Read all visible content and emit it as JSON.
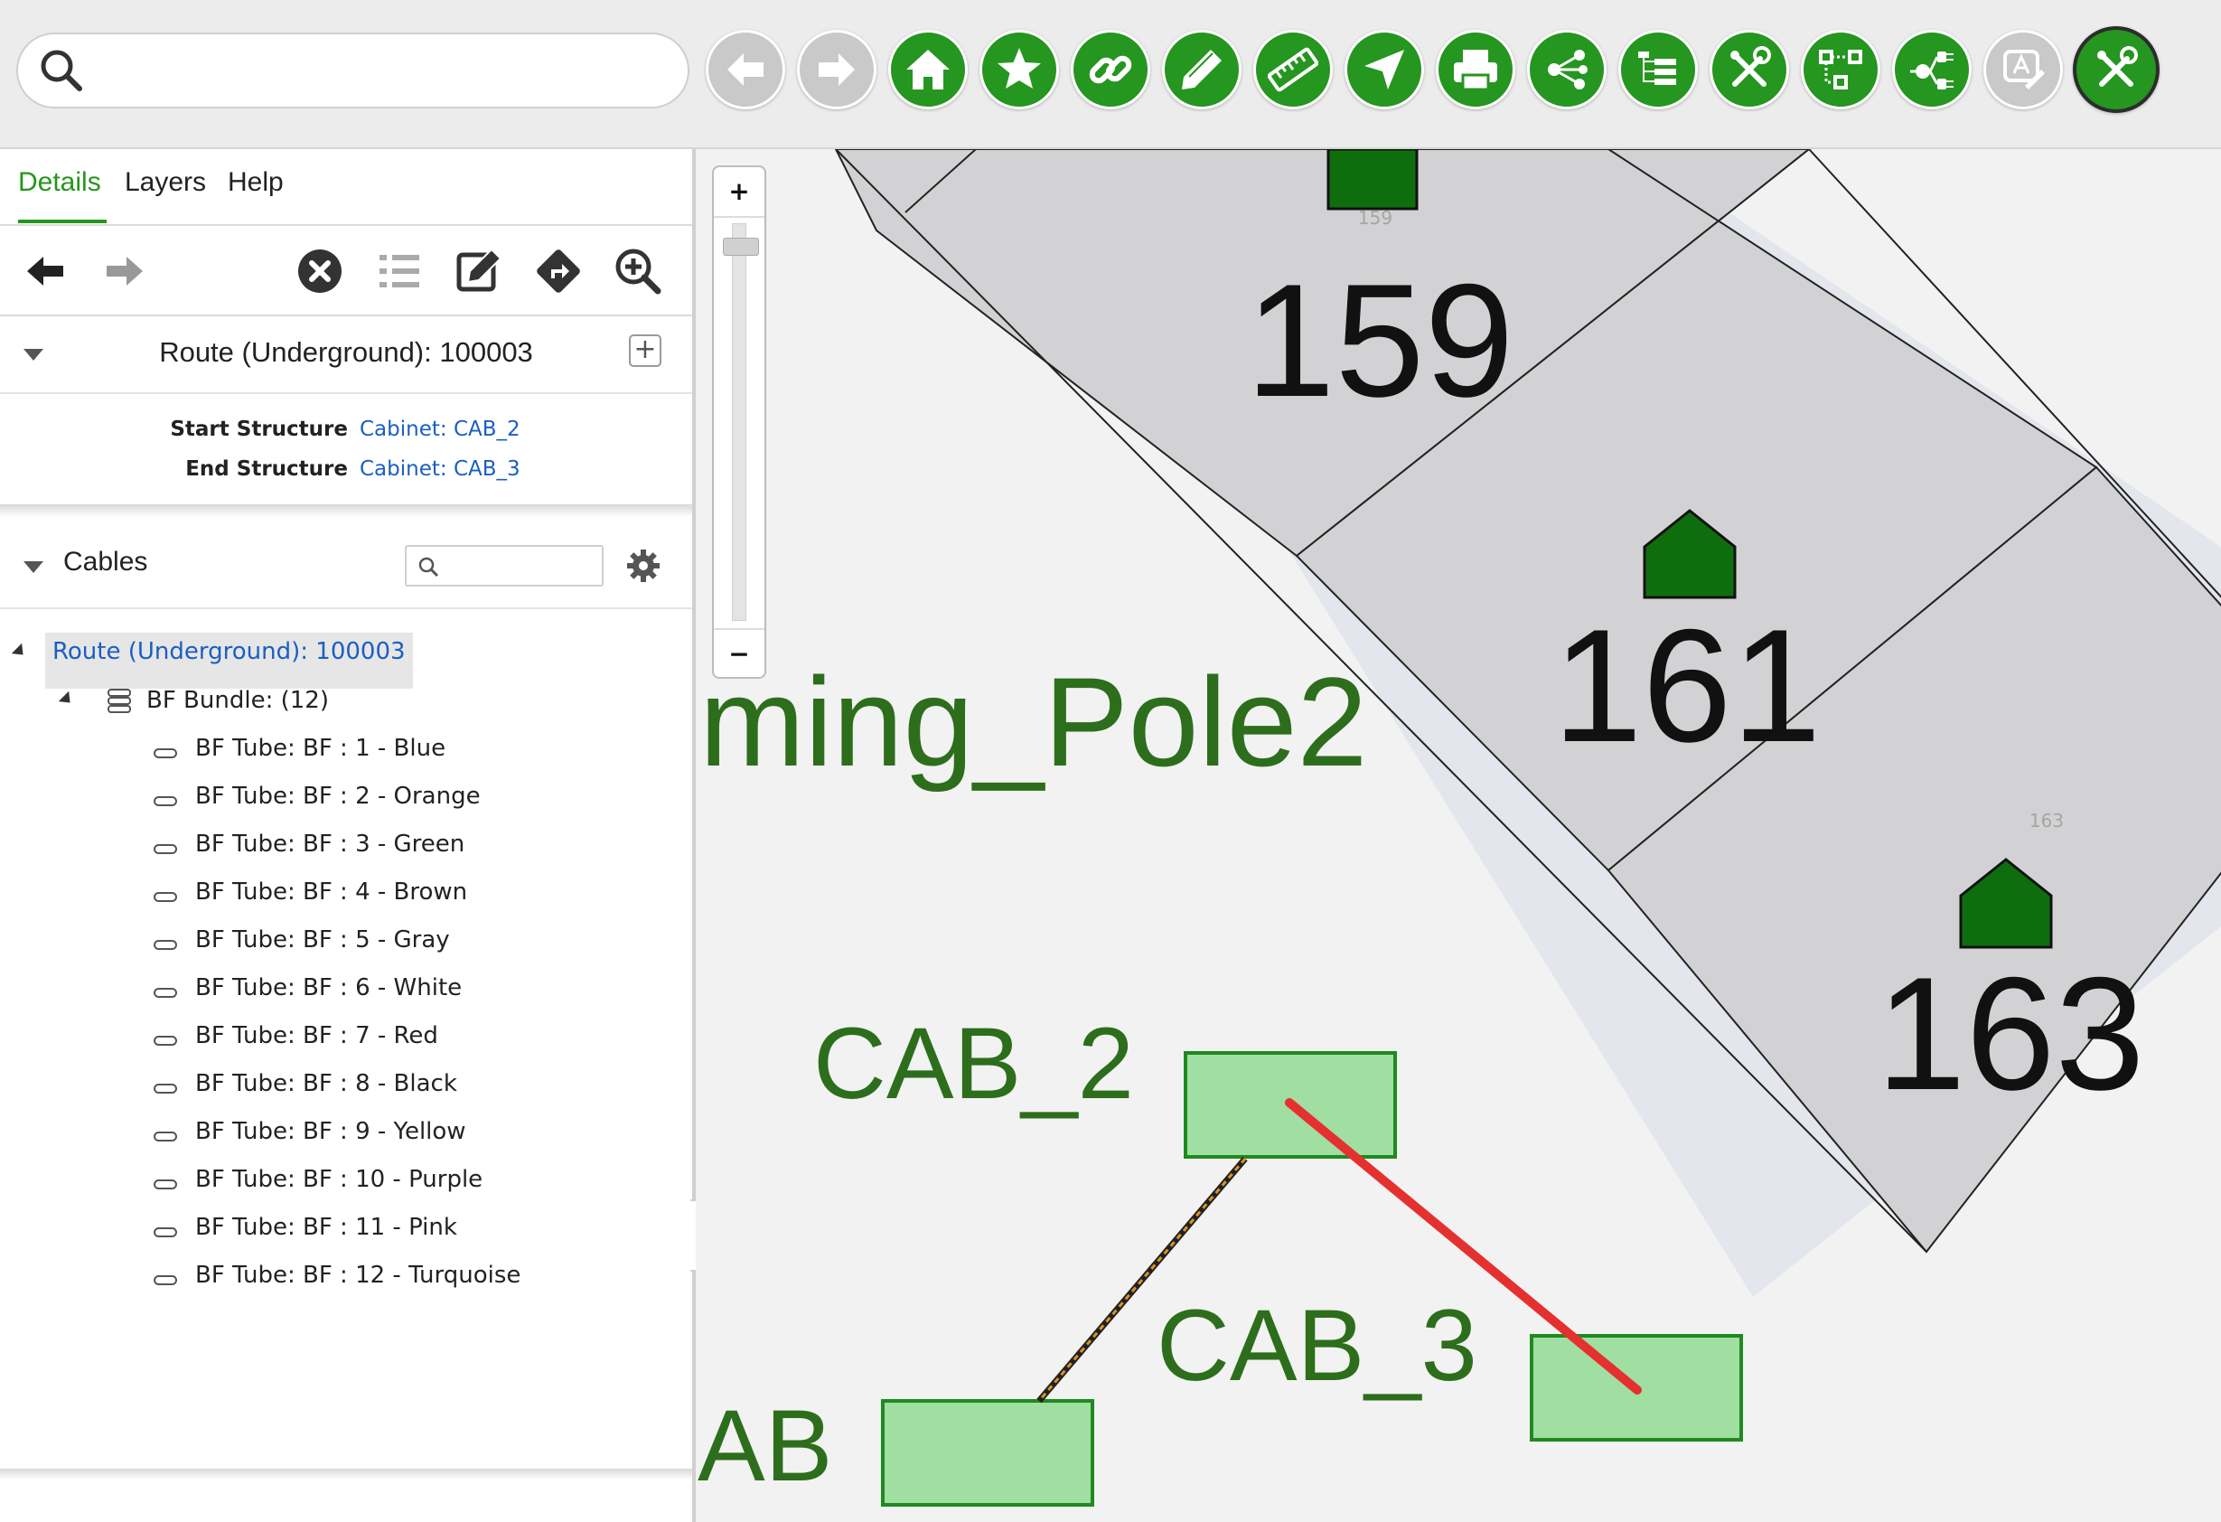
{
  "search": {
    "placeholder": "",
    "value": ""
  },
  "toolbar": {
    "buttons": [
      {
        "name": "back-button",
        "icon": "arrow-left-icon",
        "state": "disabled"
      },
      {
        "name": "forward-button",
        "icon": "arrow-right-icon",
        "state": "disabled"
      },
      {
        "name": "home-button",
        "icon": "home-icon",
        "state": "enabled"
      },
      {
        "name": "bookmark-button",
        "icon": "star-icon",
        "state": "enabled"
      },
      {
        "name": "link-button",
        "icon": "link-icon",
        "state": "enabled"
      },
      {
        "name": "edit-button",
        "icon": "pencil-icon",
        "state": "enabled"
      },
      {
        "name": "measure-button",
        "icon": "ruler-icon",
        "state": "enabled"
      },
      {
        "name": "navigate-button",
        "icon": "navigation-arrow-icon",
        "state": "enabled"
      },
      {
        "name": "print-button",
        "icon": "printer-icon",
        "state": "enabled"
      },
      {
        "name": "share-button",
        "icon": "share-icon",
        "state": "enabled"
      },
      {
        "name": "hierarchy-button",
        "icon": "tree-list-icon",
        "state": "enabled"
      },
      {
        "name": "tools-button",
        "icon": "tools-icon",
        "state": "enabled"
      },
      {
        "name": "connections-button",
        "icon": "network-nodes-icon",
        "state": "enabled"
      },
      {
        "name": "plug-button",
        "icon": "plug-icon",
        "state": "enabled"
      },
      {
        "name": "annotate-button",
        "icon": "text-annotation-icon",
        "state": "disabled"
      },
      {
        "name": "active-tools-button",
        "icon": "tools-icon",
        "state": "active"
      }
    ]
  },
  "tabs": [
    {
      "label": "Details",
      "active": true
    },
    {
      "label": "Layers",
      "active": false
    },
    {
      "label": "Help",
      "active": false
    }
  ],
  "route": {
    "title": "Route (Underground): 100003",
    "properties": [
      {
        "label": "Start Structure",
        "value": "Cabinet: CAB_2"
      },
      {
        "label": "End Structure",
        "value": "Cabinet: CAB_3"
      }
    ]
  },
  "cables": {
    "title": "Cables",
    "search_placeholder": "",
    "tree": {
      "root": "Route (Underground): 100003",
      "bundle": "BF Bundle: (12)",
      "tubes": [
        "BF Tube: BF : 1 - Blue",
        "BF Tube: BF : 2 - Orange",
        "BF Tube: BF : 3 - Green",
        "BF Tube: BF : 4 - Brown",
        "BF Tube: BF : 5 - Gray",
        "BF Tube: BF : 6 - White",
        "BF Tube: BF : 7 - Red",
        "BF Tube: BF : 8 - Black",
        "BF Tube: BF : 9 - Yellow",
        "BF Tube: BF : 10 - Purple",
        "BF Tube: BF : 11 - Pink",
        "BF Tube: BF : 12 - Turquoise"
      ]
    }
  },
  "map": {
    "zoom_in": "+",
    "zoom_out": "−",
    "plots": [
      {
        "number": "159",
        "small_label": "159"
      },
      {
        "number": "161",
        "small_label": ""
      },
      {
        "number": "163",
        "small_label": "163"
      }
    ],
    "labels": {
      "pole": "ming_Pole2",
      "cab2": "CAB_2",
      "cab3": "CAB_3",
      "cab_partial": "AB"
    }
  },
  "colors": {
    "accent": "#25961f",
    "link": "#1b5fc1",
    "map_label": "#2d6e1c",
    "cabinet_fill": "#a1dea1",
    "cabinet_border": "#1f8a1f",
    "route_selected": "#e53030",
    "route_other": "#e0911e",
    "plot_fill": "#d2d2d4",
    "building": "#0e6e0e"
  }
}
